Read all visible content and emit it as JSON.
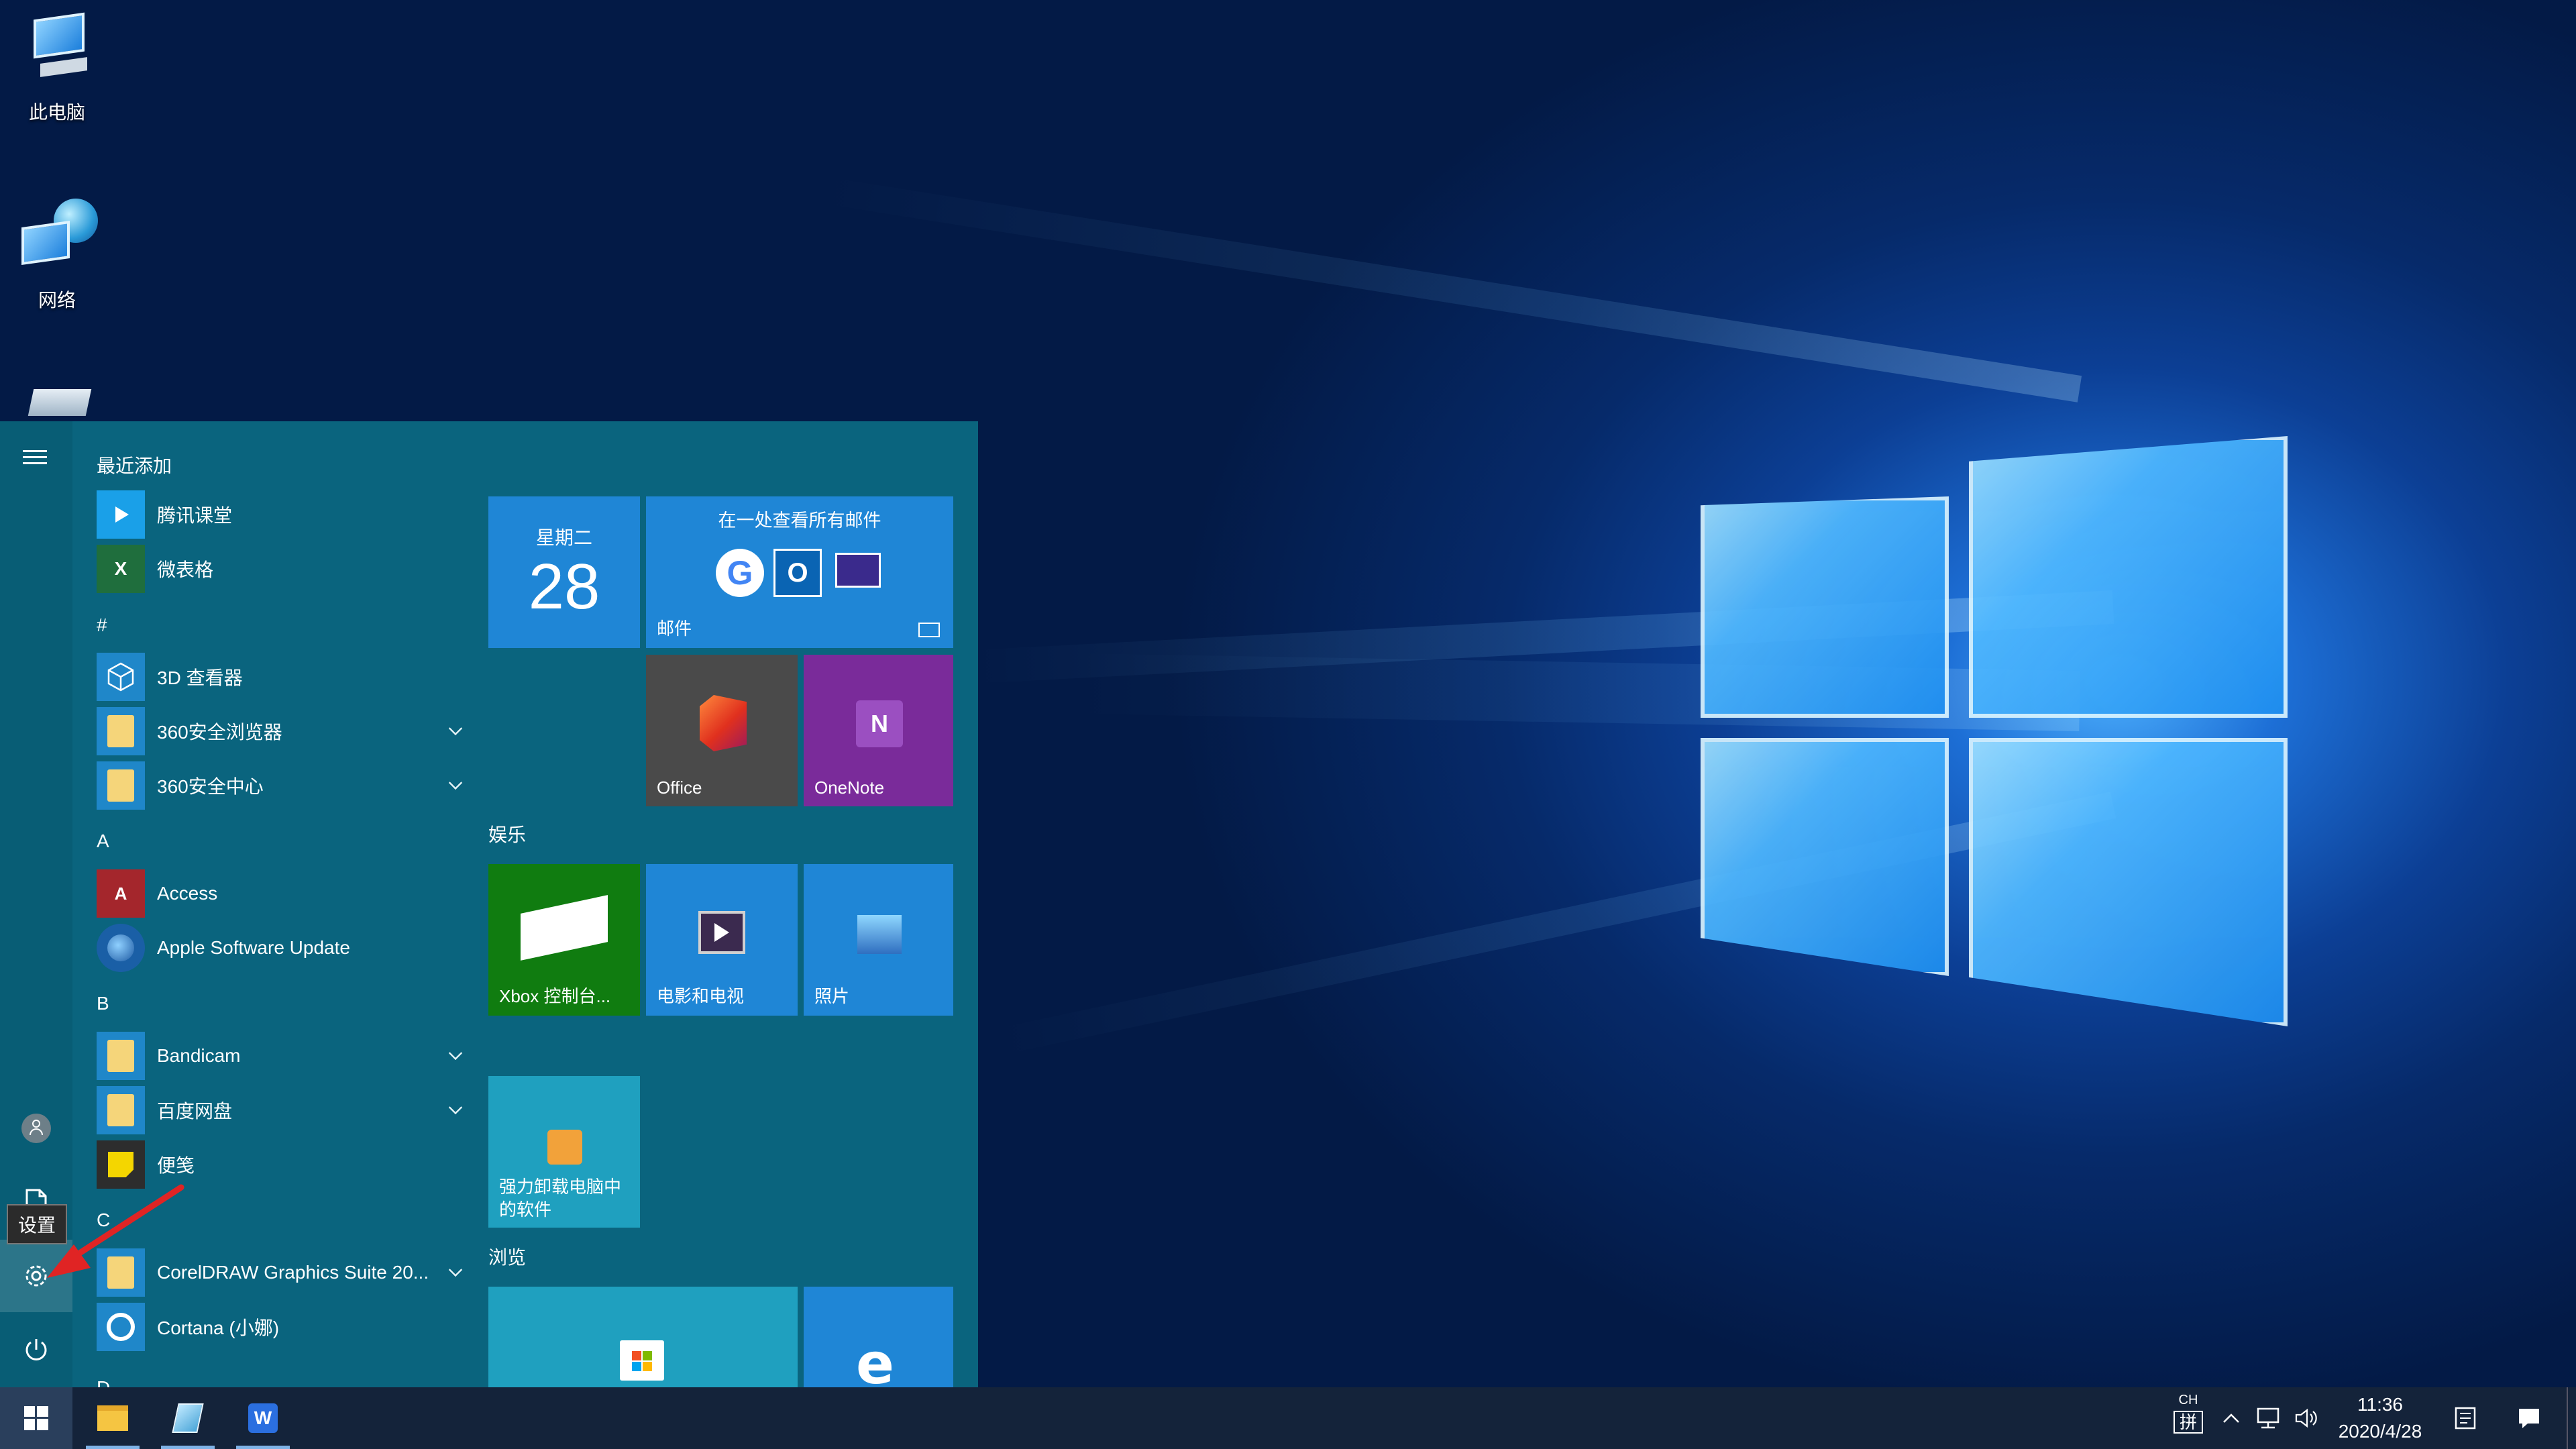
{
  "desktop": {
    "icons": [
      {
        "label": "此电脑",
        "icon": "computer-icon"
      },
      {
        "label": "网络",
        "icon": "network-icon"
      },
      {
        "label": "",
        "icon": "recycle-bin-icon"
      }
    ]
  },
  "start_menu": {
    "rail": {
      "menu_icon": "hamburger-icon",
      "user_icon": "user-icon",
      "documents_icon": "document-icon",
      "settings_icon": "gear-icon",
      "power_icon": "power-icon",
      "settings_tooltip": "设置"
    },
    "app_list": {
      "recent_header": "最近添加",
      "recent": [
        {
          "label": "腾讯课堂"
        },
        {
          "label": "微表格"
        }
      ],
      "groups": [
        {
          "header": "#",
          "items": [
            {
              "label": "3D 查看器"
            },
            {
              "label": "360安全浏览器"
            },
            {
              "label": "360安全中心"
            }
          ]
        },
        {
          "header": "A",
          "items": [
            {
              "label": "Access"
            },
            {
              "label": "Apple Software Update"
            }
          ]
        },
        {
          "header": "B",
          "items": [
            {
              "label": "Bandicam"
            },
            {
              "label": "百度网盘"
            },
            {
              "label": "便笺"
            }
          ]
        },
        {
          "header": "C",
          "items": [
            {
              "label": "CorelDRAW Graphics Suite 20..."
            },
            {
              "label": "Cortana (小娜)"
            }
          ]
        },
        {
          "header": "D",
          "items": []
        }
      ]
    },
    "tiles": {
      "calendar": {
        "day": "星期二",
        "date": "28"
      },
      "mail": {
        "title": "在一处查看所有邮件",
        "label": "邮件"
      },
      "office": {
        "label": "Office"
      },
      "onenote": {
        "label": "OneNote"
      },
      "entertainment_title": "娱乐",
      "xbox": {
        "label": "Xbox 控制台..."
      },
      "movies": {
        "label": "电影和电视"
      },
      "photos": {
        "label": "照片"
      },
      "uninstall": {
        "label": "强力卸载电脑中的软件"
      },
      "browse_title": "浏览"
    }
  },
  "taskbar": {
    "start_icon": "windows-icon",
    "pinned": [
      {
        "icon": "file-explorer-icon"
      },
      {
        "icon": "notepad-icon"
      },
      {
        "icon": "wps-icon"
      }
    ],
    "tray": {
      "ime_top": "CH",
      "ime_bottom": "拼",
      "time": "11:36",
      "date": "2020/4/28"
    }
  }
}
